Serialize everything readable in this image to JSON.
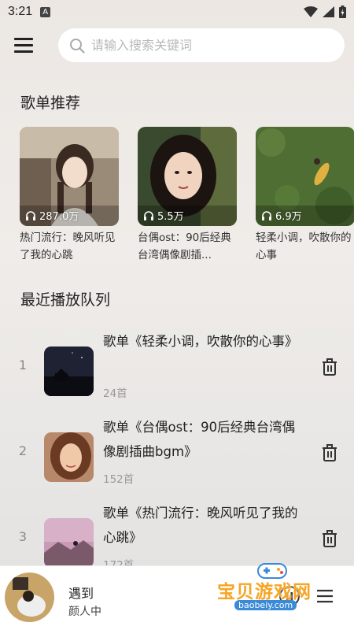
{
  "status": {
    "time": "3:21",
    "notif_letter": "A"
  },
  "search": {
    "placeholder": "请输入搜索关键词"
  },
  "sections": {
    "recommend_title": "歌单推荐",
    "queue_title": "最近播放队列"
  },
  "playlists": [
    {
      "count": "287.0万",
      "title": "热门流行：晚风听见了我的心跳"
    },
    {
      "count": "5.5万",
      "title": "台偶ost：90后经典台湾偶像剧插..."
    },
    {
      "count": "6.9万",
      "title": "轻柔小调，吹散你的心事"
    }
  ],
  "queue": [
    {
      "index": "1",
      "title": "歌单《轻柔小调，吹散你的心事》",
      "count": "24首"
    },
    {
      "index": "2",
      "title": "歌单《台偶ost：90后经典台湾偶像剧插曲bgm》",
      "count": "152首"
    },
    {
      "index": "3",
      "title": "歌单《热门流行：晚风听见了我的心跳》",
      "count": "172首"
    }
  ],
  "player": {
    "song": "遇到",
    "artist": "颜人中"
  },
  "watermark": {
    "text": "宝贝游戏网",
    "url": "baobeiy.com"
  },
  "colors": {
    "accent": "#f6a524",
    "text": "#222222",
    "muted": "#999999"
  }
}
